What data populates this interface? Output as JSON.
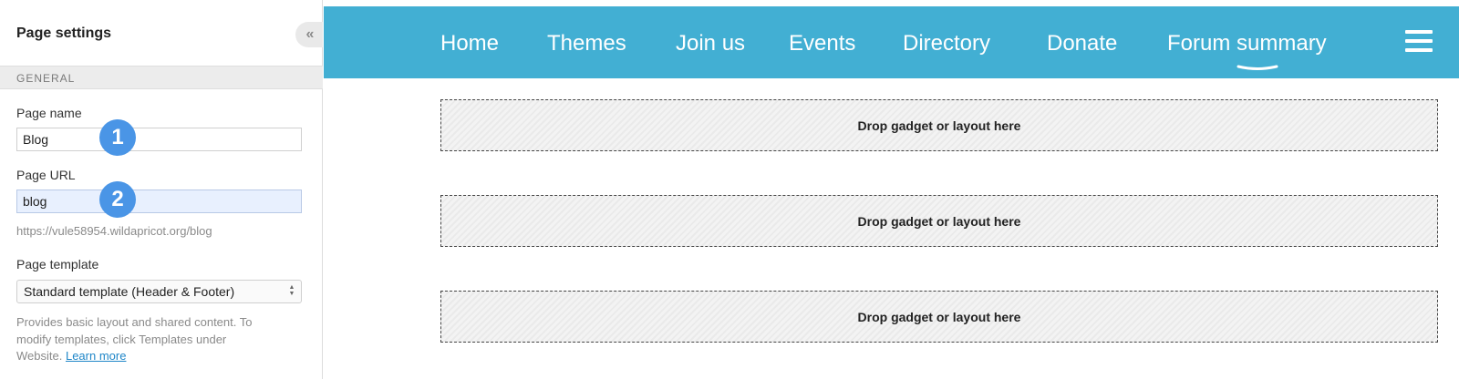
{
  "panel": {
    "title": "Page settings",
    "collapse_icon": "double-chevron-left-icon",
    "section_general": "GENERAL",
    "page_name": {
      "label": "Page name",
      "value": "Blog"
    },
    "page_url": {
      "label": "Page URL",
      "value": "blog",
      "hint": "https://vule58954.wildapricot.org/blog"
    },
    "page_template": {
      "label": "Page template",
      "selected": "Standard template (Header & Footer)",
      "help_line1": "Provides basic layout and shared content. To",
      "help_line2": "modify templates, click Templates under",
      "help_line3": "Website.",
      "help_link": "Learn more"
    }
  },
  "badges": [
    "1",
    "2"
  ],
  "nav": {
    "items": [
      "Home",
      "Themes",
      "Join us",
      "Events",
      "Directory",
      "Donate",
      "Forum summary"
    ],
    "menu_icon": "hamburger-icon",
    "colors": {
      "header_bg": "#42afd3",
      "text": "#ffffff",
      "badge": "#4a95e6"
    }
  },
  "dropzones": [
    "Drop gadget or layout here",
    "Drop gadget or layout here",
    "Drop gadget or layout here"
  ]
}
